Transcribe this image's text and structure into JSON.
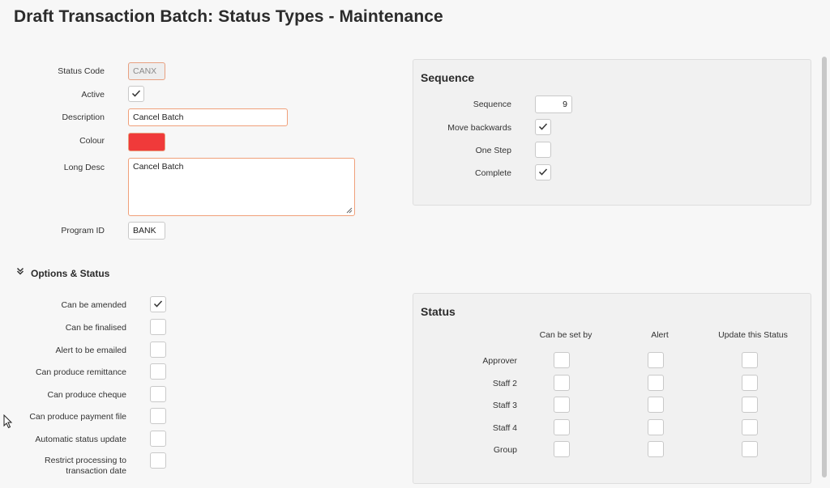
{
  "page": {
    "title": "Draft Transaction Batch: Status Types - Maintenance"
  },
  "form": {
    "status_code": {
      "label": "Status Code",
      "value": "CANX"
    },
    "active": {
      "label": "Active",
      "checked": true
    },
    "description": {
      "label": "Description",
      "value": "Cancel Batch"
    },
    "colour": {
      "label": "Colour",
      "value": "#f03a3a"
    },
    "long_desc": {
      "label": "Long Desc",
      "value": "Cancel Batch"
    },
    "program_id": {
      "label": "Program ID",
      "value": "BANK"
    }
  },
  "sequence_panel": {
    "title": "Sequence",
    "sequence": {
      "label": "Sequence",
      "value": "9"
    },
    "move_backwards": {
      "label": "Move backwards",
      "checked": true
    },
    "one_step": {
      "label": "One Step",
      "checked": false
    },
    "complete": {
      "label": "Complete",
      "checked": true
    }
  },
  "options": {
    "title": "Options & Status",
    "items": [
      {
        "label": "Can be amended",
        "checked": true
      },
      {
        "label": "Can be finalised",
        "checked": false
      },
      {
        "label": "Alert to be emailed",
        "checked": false
      },
      {
        "label": "Can produce remittance",
        "checked": false
      },
      {
        "label": "Can produce cheque",
        "checked": false
      },
      {
        "label": "Can produce payment file",
        "checked": false
      },
      {
        "label": "Automatic status update",
        "checked": false
      },
      {
        "label": "Restrict processing to",
        "label2": "transaction date",
        "checked": false
      }
    ]
  },
  "status_panel": {
    "title": "Status",
    "columns": [
      "Can be set by",
      "Alert",
      "Update this Status"
    ],
    "rows": [
      "Approver",
      "Staff 2",
      "Staff 3",
      "Staff 4",
      "Group"
    ]
  }
}
